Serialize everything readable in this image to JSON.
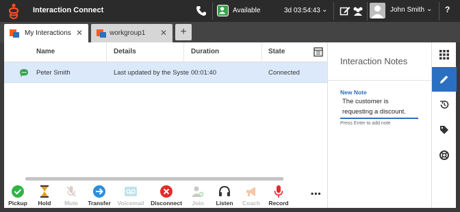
{
  "header": {
    "title": "Interaction Connect",
    "status": {
      "label": "Available",
      "duration": "3d 03:54:43"
    },
    "user": {
      "name": "John Smith"
    },
    "help": "?"
  },
  "tabs": [
    {
      "label": "My Interactions",
      "active": true
    },
    {
      "label": "workgroup1",
      "active": false
    }
  ],
  "add_tab": "+",
  "grid": {
    "columns": [
      "Name",
      "Details",
      "Duration",
      "State"
    ],
    "rows": [
      {
        "name": "Peter Smith",
        "details": "Last updated by the Syste",
        "duration": "00:01:40",
        "state": "Connected"
      }
    ]
  },
  "toolbar": {
    "buttons": [
      {
        "label": "Pickup",
        "icon": "check-circle-icon",
        "enabled": true
      },
      {
        "label": "Hold",
        "icon": "hourglass-icon",
        "enabled": true
      },
      {
        "label": "Mute",
        "icon": "mic-off-icon",
        "enabled": false
      },
      {
        "label": "Transfer",
        "icon": "arrow-right-circle-icon",
        "enabled": true
      },
      {
        "label": "Voicemail",
        "icon": "voicemail-icon",
        "enabled": false
      },
      {
        "label": "Disconnect",
        "icon": "x-circle-icon",
        "enabled": true
      },
      {
        "label": "Join",
        "icon": "add-user-icon",
        "enabled": false
      },
      {
        "label": "Listen",
        "icon": "headset-icon",
        "enabled": true
      },
      {
        "label": "Coach",
        "icon": "megaphone-icon",
        "enabled": false
      },
      {
        "label": "Record",
        "icon": "microphone-icon",
        "enabled": true
      }
    ],
    "more": "•••"
  },
  "notes": {
    "title": "Interaction Notes",
    "new_note_label": "New Note",
    "note_line1": "The customer is",
    "note_line2": "requesting a discount.",
    "hint": "Press Enter to add note"
  },
  "colors": {
    "accent": "#2a6fc0",
    "header": "#2b2b2b",
    "selected_row": "#dbe9fb",
    "available": "#37a34a"
  }
}
